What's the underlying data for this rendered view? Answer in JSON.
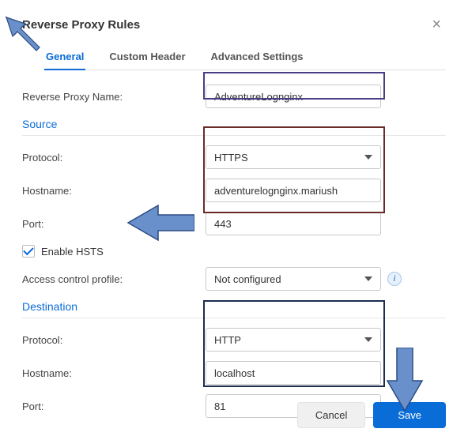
{
  "title": "Reverse Proxy Rules",
  "tabs": {
    "general": "General",
    "custom_header": "Custom Header",
    "advanced": "Advanced Settings"
  },
  "fields": {
    "name_label": "Reverse Proxy Name:",
    "name_value": "AdventureLognginx",
    "source_heading": "Source",
    "protocol_label": "Protocol:",
    "src_protocol": "HTTPS",
    "hostname_label": "Hostname:",
    "src_hostname": "adventurelognginx.mariush",
    "port_label": "Port:",
    "src_port": "443",
    "hsts_label": "Enable HSTS",
    "acp_label": "Access control profile:",
    "acp_value": "Not configured",
    "dest_heading": "Destination",
    "dst_protocol": "HTTP",
    "dst_hostname": "localhost",
    "dst_port": "81"
  },
  "buttons": {
    "cancel": "Cancel",
    "save": "Save"
  }
}
